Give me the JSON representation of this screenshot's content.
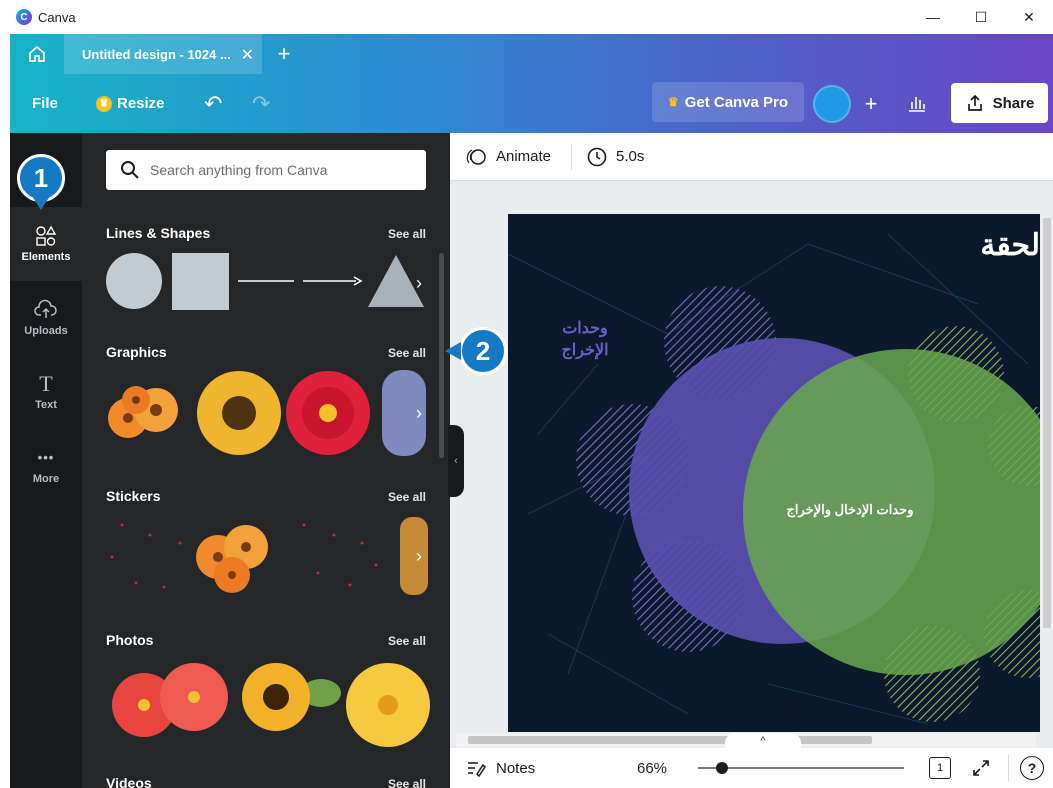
{
  "window": {
    "title": "Canva",
    "minimize": "—",
    "maximize": "☐",
    "close": "✕"
  },
  "tabs": {
    "title": "Untitled design - 1024 ...",
    "close": "✕",
    "new": "+"
  },
  "toolbar": {
    "file": "File",
    "resize": "Resize",
    "undo": "↶",
    "redo": "↷",
    "get_pro": "Get Canva Pro",
    "add": "+",
    "share": "Share"
  },
  "rail": [
    {
      "label": "Elements",
      "icon": "shapes-icon",
      "glyph": "⬡"
    },
    {
      "label": "Uploads",
      "icon": "cloud-upload-icon",
      "glyph": "☁"
    },
    {
      "label": "Text",
      "icon": "text-icon",
      "glyph": "T"
    },
    {
      "label": "More",
      "icon": "more-icon",
      "glyph": "•••"
    }
  ],
  "panel": {
    "search_placeholder": "Search anything from Canva",
    "sections": [
      {
        "title": "Lines & Shapes",
        "see_all": "See all"
      },
      {
        "title": "Graphics",
        "see_all": "See all"
      },
      {
        "title": "Stickers",
        "see_all": "See all"
      },
      {
        "title": "Photos",
        "see_all": "See all"
      },
      {
        "title": "Videos",
        "see_all": "See all"
      }
    ]
  },
  "context_bar": {
    "animate": "Animate",
    "duration": "5.0s"
  },
  "design": {
    "heading": "لحقة",
    "side_label_line1": "وحدات",
    "side_label_line2": "الإخراج",
    "center_label": "وحدات الإدخال والإخراج"
  },
  "footer": {
    "notes": "Notes",
    "zoom": "66%",
    "page": "1",
    "help": "?",
    "show_pages": "^"
  },
  "callouts": {
    "one": "1",
    "two": "2"
  },
  "colors": {
    "rail_bg": "#18191b",
    "panel_bg": "#252627",
    "callout": "#1579c3",
    "purple": "#5b4fb0",
    "green": "#6aa84f"
  }
}
